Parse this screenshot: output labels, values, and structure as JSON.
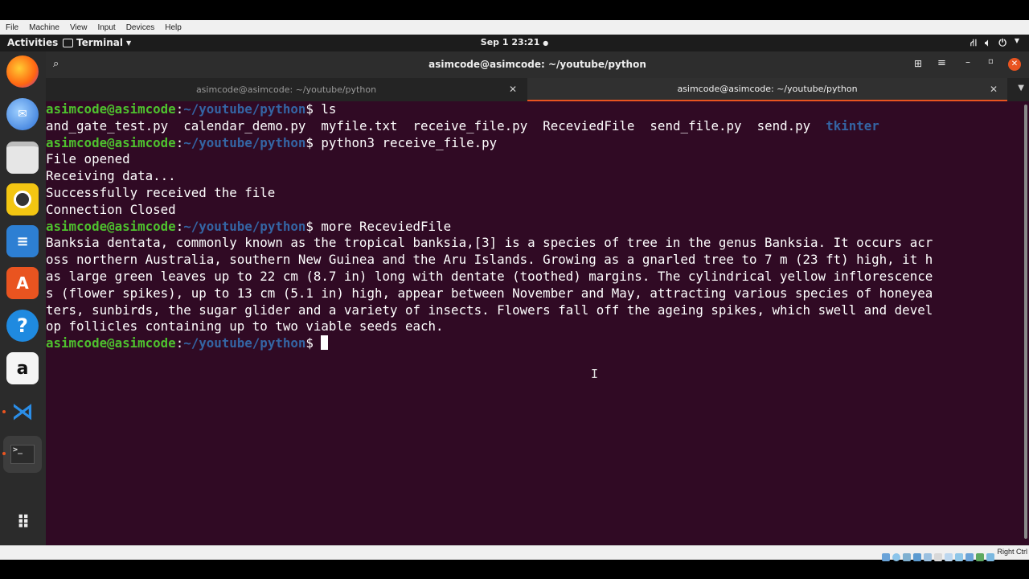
{
  "vbox_menu": [
    "File",
    "Machine",
    "View",
    "Input",
    "Devices",
    "Help"
  ],
  "topbar": {
    "activities": "Activities",
    "app_menu": "Terminal",
    "clock": "Sep 1  23:21"
  },
  "window": {
    "title": "asimcode@asimcode: ~/youtube/python",
    "tabs": [
      {
        "label": "asimcode@asimcode: ~/youtube/python",
        "active": false
      },
      {
        "label": "asimcode@asimcode: ~/youtube/python",
        "active": true
      }
    ]
  },
  "terminal": {
    "prompt_user": "asimcode@asimcode",
    "prompt_path": "~/youtube/python",
    "cmd1": "ls",
    "ls_files": [
      "and_gate_test.py",
      "calendar_demo.py",
      "myfile.txt",
      "receive_file.py",
      "ReceviedFile",
      "send_file.py",
      "send.py"
    ],
    "ls_dir": "tkinter",
    "cmd2": "python3 receive_file.py",
    "out1": "File opened",
    "out2": "Receiving data...",
    "out3": "Successfully received the file",
    "out4": "Connection Closed",
    "cmd3": "more ReceviedFile",
    "text": [
      "Banksia dentata, commonly known as the tropical banksia,[3] is a species of tree in the genus Banksia. It occurs acr",
      "oss northern Australia, southern New Guinea and the Aru Islands. Growing as a gnarled tree to 7 m (23 ft) high, it h",
      "as large green leaves up to 22 cm (8.7 in) long with dentate (toothed) margins. The cylindrical yellow inflorescence",
      "s (flower spikes), up to 13 cm (5.1 in) high, appear between November and May, attracting various species of honeyea",
      "ters, sunbirds, the sugar glider and a variety of insects. Flowers fall off the ageing spikes, which swell and devel",
      "op follicles containing up to two viable seeds each."
    ]
  },
  "statusbar": {
    "host_key": "Right Ctrl"
  },
  "dock": [
    "firefox-icon",
    "thunderbird-icon",
    "files-icon",
    "rhythmbox-icon",
    "writer-icon",
    "software-icon",
    "help-icon",
    "amazon-icon",
    "vscode-icon",
    "terminal-icon",
    "app-grid-icon"
  ]
}
